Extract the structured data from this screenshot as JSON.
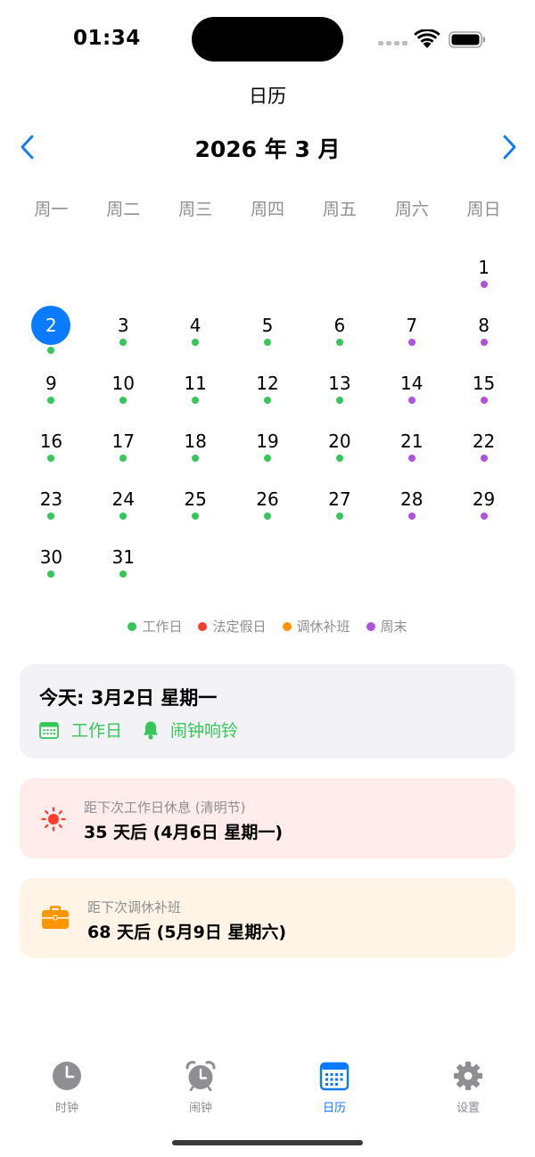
{
  "status_bar": {
    "time": "01:34"
  },
  "nav": {
    "title": "日历"
  },
  "calendar": {
    "month_title": "2026 年 3 月",
    "weekdays": [
      "周一",
      "周二",
      "周三",
      "周四",
      "周五",
      "周六",
      "周日"
    ],
    "leading_blanks": 6,
    "selected_day": 2,
    "days": [
      {
        "d": "1",
        "type": "weekend"
      },
      {
        "d": "2",
        "type": "workday"
      },
      {
        "d": "3",
        "type": "workday"
      },
      {
        "d": "4",
        "type": "workday"
      },
      {
        "d": "5",
        "type": "workday"
      },
      {
        "d": "6",
        "type": "workday"
      },
      {
        "d": "7",
        "type": "weekend"
      },
      {
        "d": "8",
        "type": "weekend"
      },
      {
        "d": "9",
        "type": "workday"
      },
      {
        "d": "10",
        "type": "workday"
      },
      {
        "d": "11",
        "type": "workday"
      },
      {
        "d": "12",
        "type": "workday"
      },
      {
        "d": "13",
        "type": "workday"
      },
      {
        "d": "14",
        "type": "weekend"
      },
      {
        "d": "15",
        "type": "weekend"
      },
      {
        "d": "16",
        "type": "workday"
      },
      {
        "d": "17",
        "type": "workday"
      },
      {
        "d": "18",
        "type": "workday"
      },
      {
        "d": "19",
        "type": "workday"
      },
      {
        "d": "20",
        "type": "workday"
      },
      {
        "d": "21",
        "type": "weekend"
      },
      {
        "d": "22",
        "type": "weekend"
      },
      {
        "d": "23",
        "type": "workday"
      },
      {
        "d": "24",
        "type": "workday"
      },
      {
        "d": "25",
        "type": "workday"
      },
      {
        "d": "26",
        "type": "workday"
      },
      {
        "d": "27",
        "type": "workday"
      },
      {
        "d": "28",
        "type": "weekend"
      },
      {
        "d": "29",
        "type": "weekend"
      },
      {
        "d": "30",
        "type": "workday"
      },
      {
        "d": "31",
        "type": "workday"
      }
    ]
  },
  "colors": {
    "workday": "#34c759",
    "holiday": "#ff3b30",
    "makeup": "#ff9500",
    "weekend": "#af52de",
    "accent": "#0a7aff"
  },
  "legend": [
    {
      "label": "工作日",
      "type": "workday"
    },
    {
      "label": "法定假日",
      "type": "holiday"
    },
    {
      "label": "调休补班",
      "type": "makeup"
    },
    {
      "label": "周末",
      "type": "weekend"
    }
  ],
  "today_card": {
    "title": "今天: 3月2日 星期一",
    "status_icon": "calendar-icon",
    "status": "工作日",
    "alarm_icon": "bell-icon",
    "alarm": "闹钟响铃"
  },
  "holiday_card": {
    "icon": "sun-icon",
    "subtitle": "距下次工作日休息 (清明节)",
    "main": "35 天后 (4月6日 星期一)"
  },
  "shift_card": {
    "icon": "briefcase-icon",
    "subtitle": "距下次调休补班",
    "main": "68 天后 (5月9日 星期六)"
  },
  "tabs": [
    {
      "label": "时钟",
      "icon": "clock-icon"
    },
    {
      "label": "闹钟",
      "icon": "alarm-clock-icon"
    },
    {
      "label": "日历",
      "icon": "calendar-icon",
      "active": true
    },
    {
      "label": "设置",
      "icon": "gear-icon"
    }
  ]
}
